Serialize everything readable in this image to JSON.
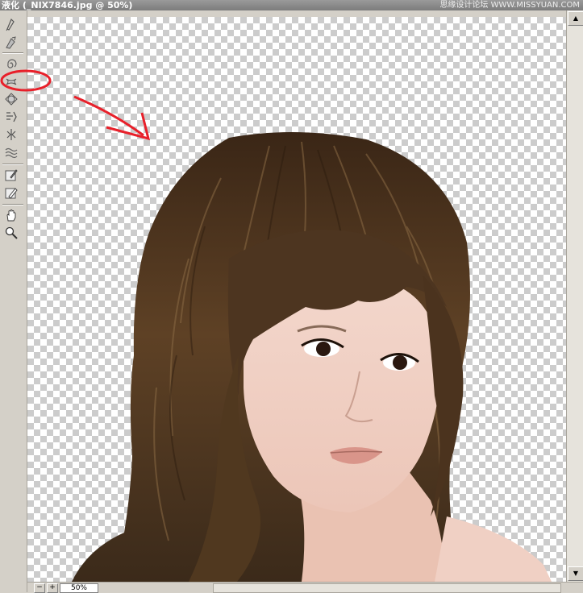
{
  "window": {
    "title": "液化 (_NIX7846.jpg @ 50%)",
    "watermark": "思缘设计论坛 WWW.MISSYUAN.COM"
  },
  "tools": [
    {
      "name": "forward-warp-tool",
      "icon": "warp-icon"
    },
    {
      "name": "reconstruct-tool",
      "icon": "reconstruct-icon"
    },
    {
      "name": "twirl-clockwise-tool",
      "icon": "twirl-icon"
    },
    {
      "name": "pucker-tool",
      "icon": "pucker-icon"
    },
    {
      "name": "bloat-tool",
      "icon": "bloat-icon"
    },
    {
      "name": "push-left-tool",
      "icon": "push-left-icon"
    },
    {
      "name": "mirror-tool",
      "icon": "mirror-icon"
    },
    {
      "name": "turbulence-tool",
      "icon": "turbulence-icon"
    },
    {
      "name": "freeze-mask-tool",
      "icon": "freeze-mask-icon"
    },
    {
      "name": "thaw-mask-tool",
      "icon": "thaw-mask-icon"
    },
    {
      "name": "hand-tool",
      "icon": "hand-icon"
    },
    {
      "name": "zoom-tool",
      "icon": "zoom-icon"
    }
  ],
  "statusbar": {
    "zoom_value": "50%",
    "zoom_minus": "−",
    "zoom_plus": "+"
  },
  "colors": {
    "annotation": "#e8202a",
    "chrome": "#d4d0c8",
    "hair": "#4a3421"
  }
}
